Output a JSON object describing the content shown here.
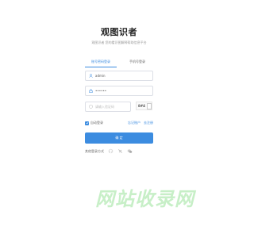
{
  "header": {
    "title": "观图识者",
    "subtitle": "观图识者 您的看识图解释帮助信息平台"
  },
  "tabs": [
    {
      "label": "账号密码登录",
      "active": true
    },
    {
      "label": "手机号登录",
      "active": false
    }
  ],
  "form": {
    "username_value": "admin",
    "password_value": "••••••",
    "captcha_placeholder": "请输入验证码",
    "captcha_text": "8#4"
  },
  "remember": {
    "label": "自动登录",
    "checked": true
  },
  "links": {
    "forgot": "忘记账户",
    "register": "去注册"
  },
  "submit_label": "确 定",
  "other_login": {
    "label": "其他登录方式",
    "icons": [
      "github-icon",
      "alipay-icon",
      "wechat-icon"
    ]
  },
  "watermark": {
    "text": "网站收录网"
  },
  "colors": {
    "accent": "#3c8ce0",
    "watermark": "#9be39b"
  }
}
